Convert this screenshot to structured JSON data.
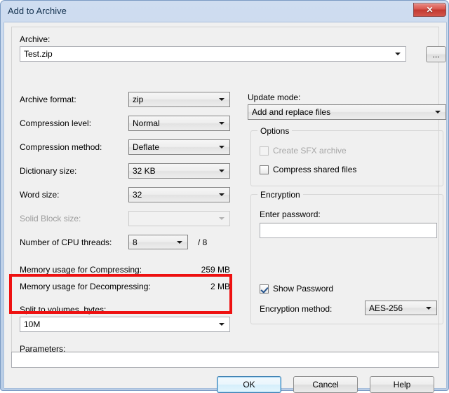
{
  "window": {
    "title": "Add to Archive",
    "close_label": "✕",
    "close_icon": "close-icon"
  },
  "archive": {
    "label": "Archive:",
    "value": "Test.zip",
    "browse_label": "...",
    "dropdown_icon": "chevron-down-icon"
  },
  "left_fields": [
    {
      "label": "Archive format:",
      "value": "zip",
      "disabled": false
    },
    {
      "label": "Compression level:",
      "value": "Normal",
      "disabled": false
    },
    {
      "label": "Compression method:",
      "value": "Deflate",
      "disabled": false
    },
    {
      "label": "Dictionary size:",
      "value": "32 KB",
      "disabled": false
    },
    {
      "label": "Word size:",
      "value": "32",
      "disabled": false
    },
    {
      "label": "Solid Block size:",
      "value": "",
      "disabled": true
    }
  ],
  "cpu": {
    "label": "Number of CPU threads:",
    "value": "8",
    "max_label": "/ 8"
  },
  "memory": [
    {
      "label": "Memory usage for Compressing:",
      "value": "259 MB"
    },
    {
      "label": "Memory usage for Decompressing:",
      "value": "2 MB"
    }
  ],
  "split": {
    "label": "Split to volumes, bytes:",
    "value": "10M",
    "highlighted": true,
    "highlight_color": "#ee1111"
  },
  "parameters": {
    "label": "Parameters:",
    "value": ""
  },
  "update_mode": {
    "label": "Update mode:",
    "value": "Add and replace files"
  },
  "options_group": {
    "title": "Options",
    "items": [
      {
        "label": "Create SFX archive",
        "checked": false,
        "disabled": true
      },
      {
        "label": "Compress shared files",
        "checked": false,
        "disabled": false
      }
    ]
  },
  "encryption_group": {
    "title": "Encryption",
    "password_label": "Enter password:",
    "password_value": "",
    "show_password": {
      "label": "Show Password",
      "checked": true
    },
    "method_label": "Encryption method:",
    "method_value": "AES-256"
  },
  "buttons": {
    "ok": "OK",
    "cancel": "Cancel",
    "help": "Help"
  }
}
